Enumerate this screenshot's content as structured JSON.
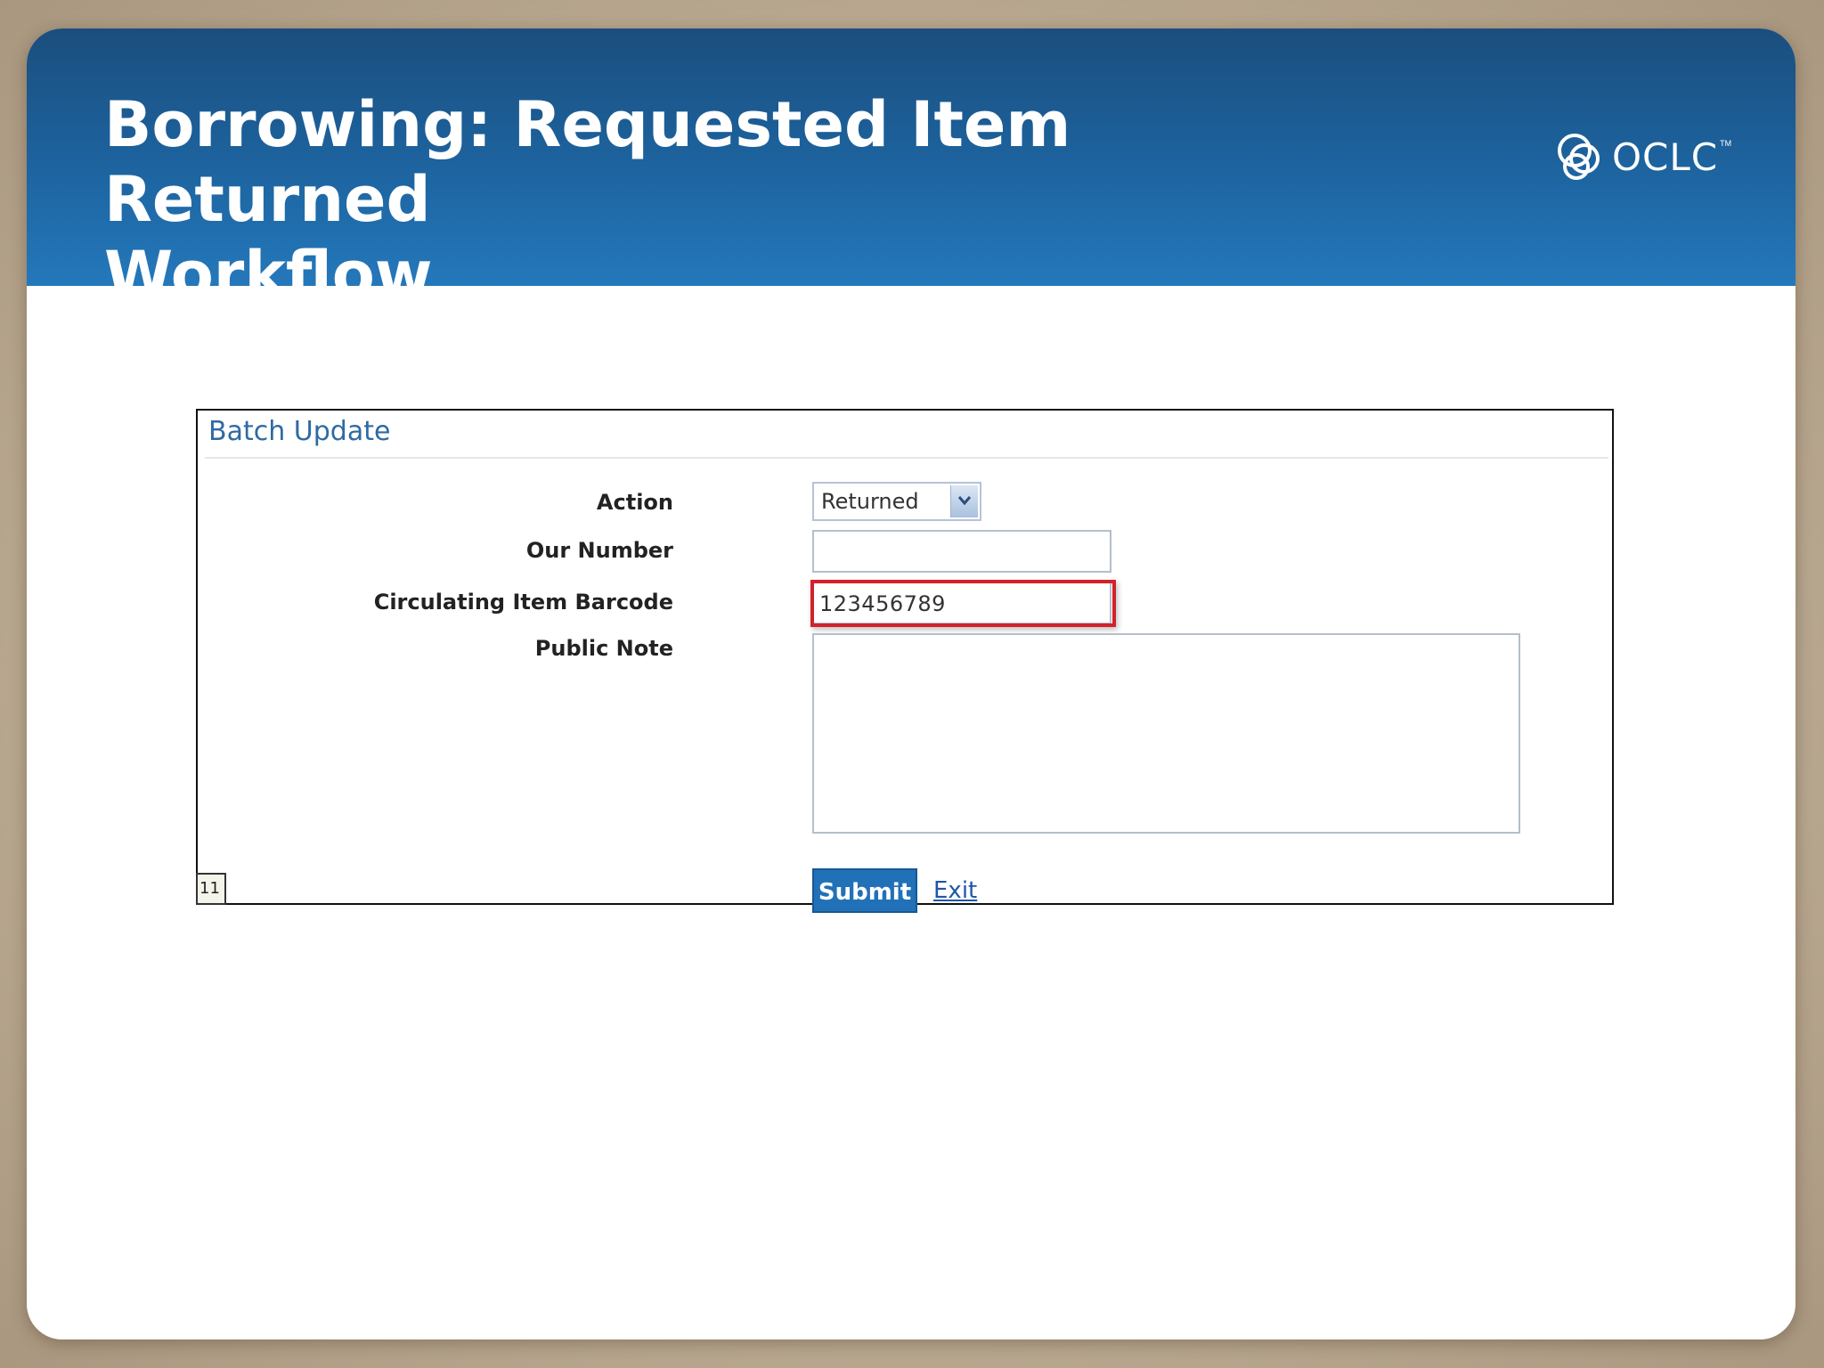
{
  "slide": {
    "title_line1": "Borrowing: Requested Item Returned",
    "title_line2": "Workflow",
    "logo_text": "OCLC",
    "logo_tm": "TM"
  },
  "form": {
    "heading": "Batch Update",
    "action_label": "Action",
    "action_value": "Returned",
    "our_number_label": "Our Number",
    "our_number_value": "",
    "barcode_label": "Circulating Item Barcode",
    "barcode_value": "123456789",
    "public_note_label": "Public Note",
    "public_note_value": "",
    "submit_label": "Submit",
    "exit_label": "Exit",
    "page_number": "11"
  },
  "colors": {
    "header": "#1d64a0",
    "highlight": "#d3202b",
    "submit": "#2171b8",
    "heading": "#2f6aa3"
  },
  "icons": {
    "logo": "oclc-logo-icon",
    "dropdown": "chevron-down-icon"
  }
}
